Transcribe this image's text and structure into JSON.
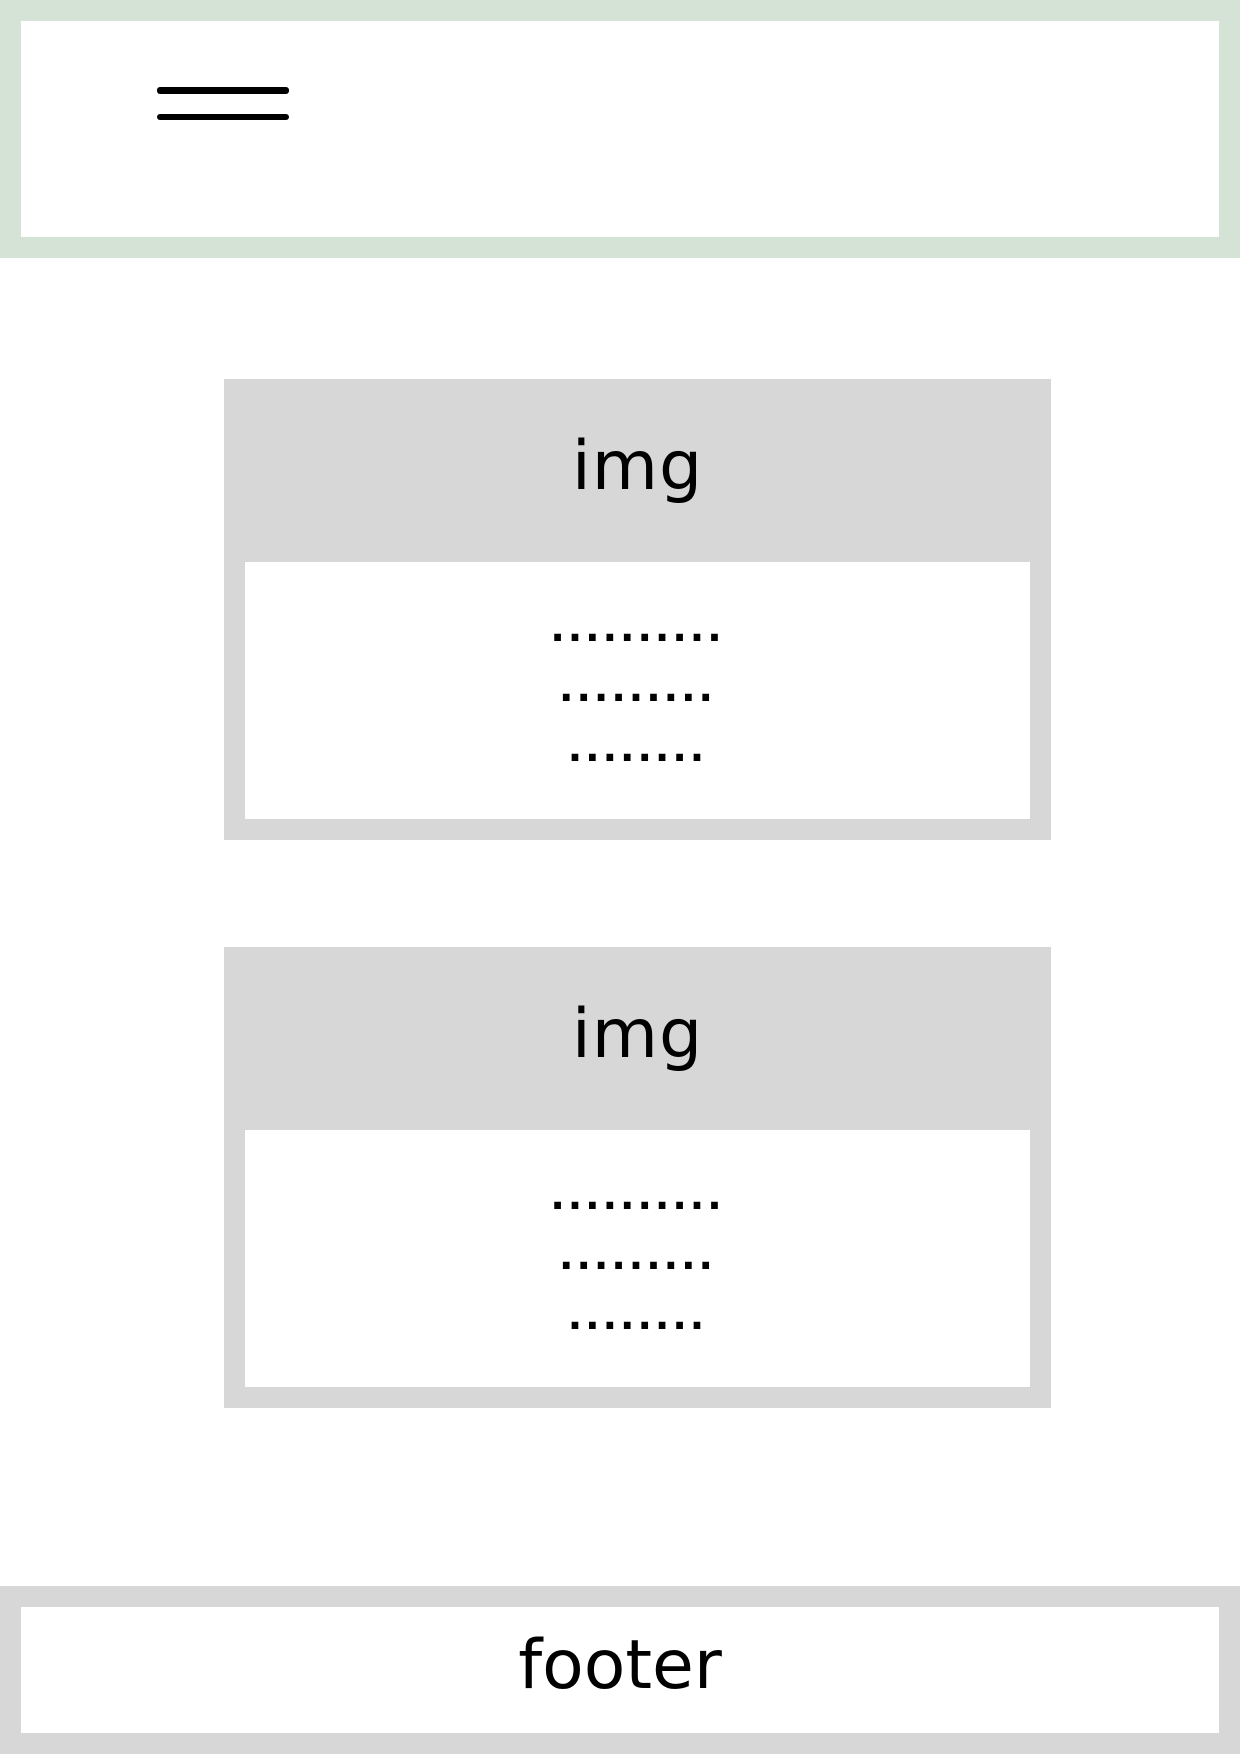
{
  "header": {
    "menu_icon": "hamburger-menu-icon"
  },
  "cards": [
    {
      "image_label": "img",
      "lines": [
        "..........",
        ".........",
        "........"
      ]
    },
    {
      "image_label": "img",
      "lines": [
        "..........",
        ".........",
        "........"
      ]
    }
  ],
  "footer": {
    "label": "footer"
  },
  "colors": {
    "header_border": "#d5e2d6",
    "card_gray": "#d7d7d7",
    "footer_border": "#d7d7d7",
    "background": "#ffffff",
    "text": "#000000"
  }
}
